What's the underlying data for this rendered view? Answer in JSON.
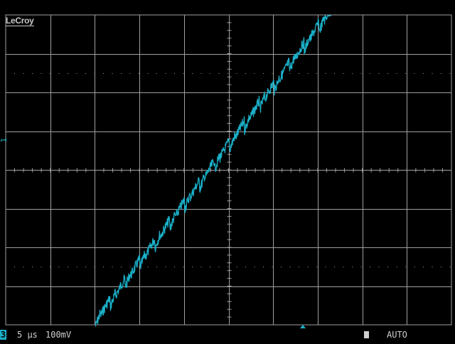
{
  "brand": "LeCroy",
  "channel": {
    "marker": "1",
    "number": "3",
    "time_per_div": "5 µs",
    "volts_per_div": "100mV",
    "trace_color": "#1ab0c8"
  },
  "trigger": {
    "mode": "AUTO"
  },
  "colors": {
    "grid": "#a0a0a0",
    "background": "#000000"
  }
}
